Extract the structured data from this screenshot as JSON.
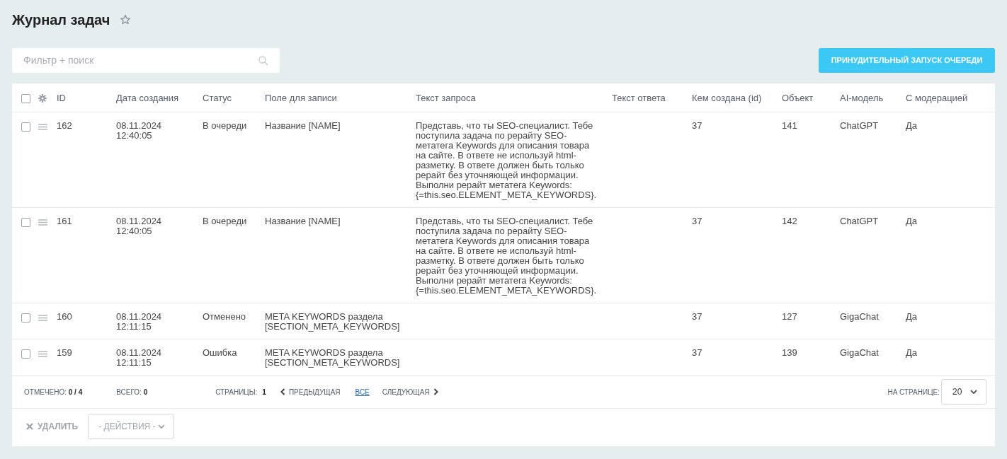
{
  "page": {
    "title": "Журнал задач"
  },
  "filter": {
    "placeholder": "Фильтр + поиск"
  },
  "run_button": "ПРИНУДИТЕЛЬНЫЙ ЗАПУСК ОЧЕРЕДИ",
  "table": {
    "all_checked": false,
    "columns": [
      "ID",
      "Дата создания",
      "Статус",
      "Поле для записи",
      "Текст запроса",
      "Текст ответа",
      "Кем создана (id)",
      "Объект",
      "AI-модель",
      "С модерацией"
    ],
    "rows": [
      {
        "checked": false,
        "id": "162",
        "date": "08.11.2024",
        "time": "12:40:05",
        "status": "В очереди",
        "field": "Название [NAME]",
        "request": "Представь, что ты SEO-специалист. Тебе поступила задача по рерайту SEO-метатега Keywords для описания товара на сайте. В ответе не используй html-разметку. В ответе должен быть только рерайт без уточняющей информации. Выполни рерайт метатега Keywords: {=this.seo.ELEMENT_META_KEYWORDS}.",
        "creator": "37",
        "object": "141",
        "model": "ChatGPT",
        "moderation": "Да"
      },
      {
        "checked": false,
        "id": "161",
        "date": "08.11.2024",
        "time": "12:40:05",
        "status": "В очереди",
        "field": "Название [NAME]",
        "request": "Представь, что ты SEO-специалист. Тебе поступила задача по рерайту SEO-метатега Keywords для описания товара на сайте. В ответе не используй html-разметку. В ответе должен быть только рерайт без уточняющей информации. Выполни рерайт метатега Keywords: {=this.seo.ELEMENT_META_KEYWORDS}.",
        "creator": "37",
        "object": "142",
        "model": "ChatGPT",
        "moderation": "Да"
      },
      {
        "checked": false,
        "id": "160",
        "date": "08.11.2024",
        "time": "12:11:15",
        "status": "Отменено",
        "field": "META KEYWORDS раздела [SECTION_META_KEYWORDS]",
        "creator": "37",
        "object": "127",
        "model": "GigaChat",
        "moderation": "Да"
      },
      {
        "checked": false,
        "id": "159",
        "date": "08.11.2024",
        "time": "12:11:15",
        "status": "Ошибка",
        "field": "META KEYWORDS раздела [SECTION_META_KEYWORDS]",
        "creator": "37",
        "object": "139",
        "model": "GigaChat",
        "moderation": "Да"
      }
    ]
  },
  "footer": {
    "checked_label": "ОТМЕЧЕНО:",
    "checked_value": "0 / 4",
    "total_label": "ВСЕГО:",
    "total_value": "0",
    "pages_label": "СТРАНИЦЫ:",
    "page": "1",
    "prev": "ПРЕДЫДУЩАЯ",
    "all": "ВСЕ",
    "next": "СЛЕДУЮЩАЯ",
    "per_page_label": "НА СТРАНИЦЕ:",
    "per_page": "20"
  },
  "actions": {
    "delete": {
      "label": "УДАЛИТЬ",
      "disabled": true
    },
    "select": {
      "label": "- ДЕЙСТВИЯ -",
      "disabled": true
    }
  }
}
